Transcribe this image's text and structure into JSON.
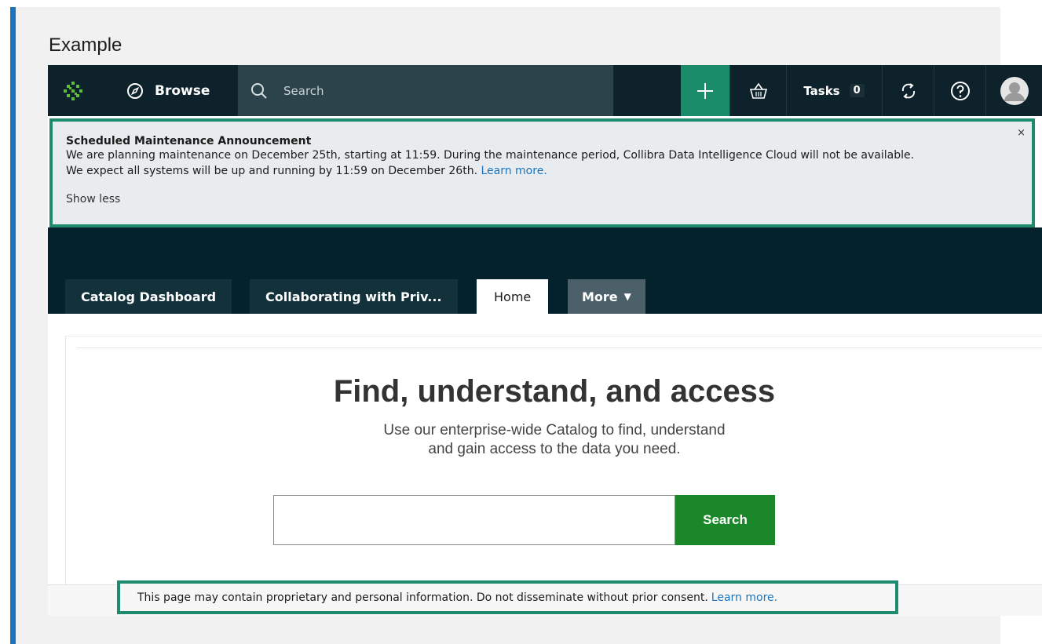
{
  "example_label": "Example",
  "nav": {
    "browse_label": "Browse",
    "search_placeholder": "Search",
    "tasks_label": "Tasks",
    "tasks_count": "0"
  },
  "announcement": {
    "title": "Scheduled Maintenance Announcement",
    "line1": "We are planning maintenance on December 25th, starting at 11:59. During the maintenance period, Collibra Data Intelligence Cloud will not be available.",
    "line2": "We expect all systems will be up and running by 11:59 on December 26th.",
    "learn_more": "Learn more.",
    "show_less": "Show less",
    "close": "×"
  },
  "tabs": [
    {
      "label": "Catalog Dashboard"
    },
    {
      "label": "Collaborating with Priv..."
    },
    {
      "label": "Home"
    },
    {
      "label": "More"
    }
  ],
  "main": {
    "headline": "Find, understand, and access",
    "subline1": "Use our enterprise-wide Catalog to find, understand",
    "subline2": "and gain access to the data you need.",
    "search_button": "Search"
  },
  "footer": {
    "notice": "This page may contain proprietary and personal information. Do not disseminate without prior consent.",
    "learn_more": "Learn more."
  },
  "colors": {
    "nav_bg": "#0d222a",
    "accent_green": "#1a8c6a",
    "highlight_border": "#1e8a6e",
    "search_button": "#1a8728",
    "link": "#1c75bc"
  }
}
